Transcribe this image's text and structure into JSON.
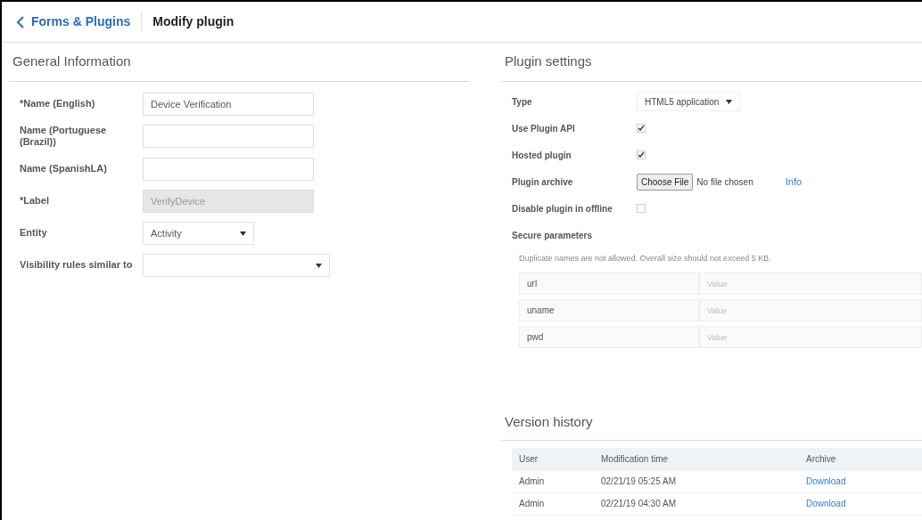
{
  "header": {
    "back_label": "Forms & Plugins",
    "title": "Modify plugin"
  },
  "general": {
    "title": "General Information",
    "fields": [
      {
        "kind": "text",
        "label": "*Name (English)",
        "value": "Device Verification",
        "disabled": false
      },
      {
        "kind": "text",
        "label": "Name (Portuguese (Brazil))",
        "disabled": false
      },
      {
        "kind": "text",
        "label": "Name (SpanishLA)",
        "disabled": false
      },
      {
        "kind": "text",
        "label": "*Label",
        "value": "VerifyDevice",
        "disabled": true
      },
      {
        "kind": "select",
        "label": "Entity",
        "value": "Activity",
        "wide": false
      },
      {
        "kind": "select",
        "label": "Visibility rules similar to",
        "wide": true
      }
    ]
  },
  "settings": {
    "title": "Plugin settings",
    "rows": [
      {
        "kind": "select",
        "label": "Type",
        "value": "HTML5 application"
      },
      {
        "kind": "checkbox",
        "label": "Use Plugin API",
        "checked": true
      },
      {
        "kind": "checkbox",
        "label": "Hosted plugin",
        "checked": true
      },
      {
        "kind": "file",
        "label": "Plugin archive",
        "button": "Choose File",
        "status": "No file chosen",
        "link": "Info"
      },
      {
        "kind": "checkbox",
        "label": "Disable plugin in offline",
        "checked": false
      }
    ],
    "secure": {
      "title": "Secure parameters",
      "note": "Duplicate names are not allowed. Overall size should not exceed 5 KB.",
      "params": [
        {
          "name": "url",
          "placeholder": "Value"
        },
        {
          "name": "uname",
          "placeholder": "Value"
        },
        {
          "name": "pwd",
          "placeholder": "Value"
        }
      ]
    }
  },
  "history": {
    "title": "Version history",
    "columns": [
      "User",
      "Modification time",
      "Archive"
    ],
    "rows": [
      [
        "Admin",
        "02/21/19 05:25 AM",
        "Download"
      ],
      [
        "Admin",
        "02/21/19 04:30 AM",
        "Download"
      ]
    ]
  }
}
